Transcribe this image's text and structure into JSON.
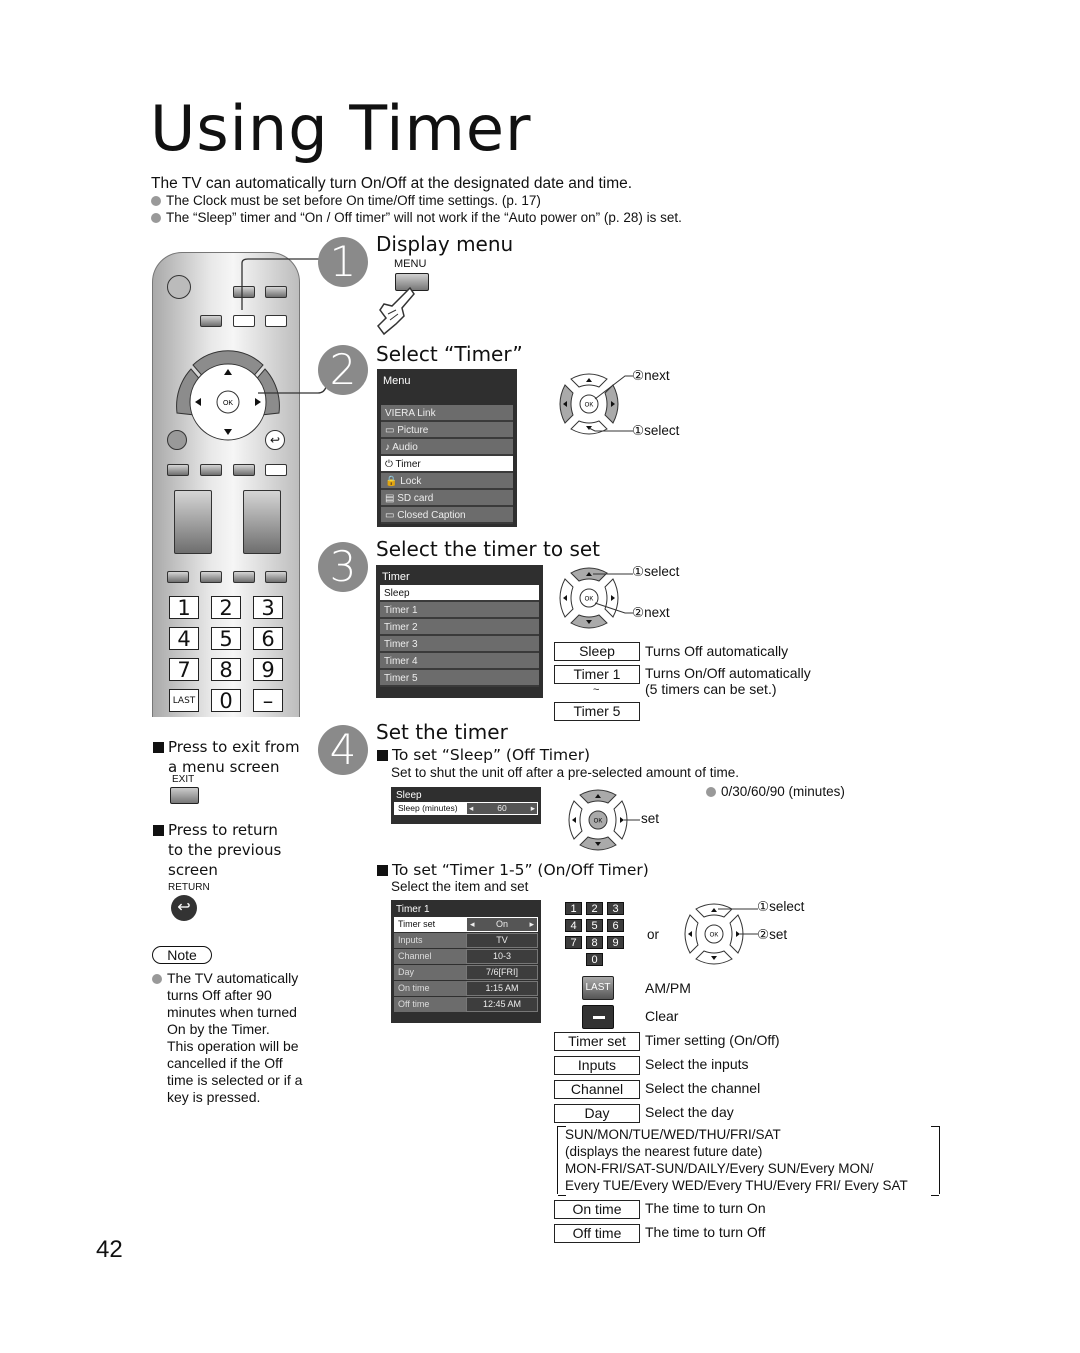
{
  "page": {
    "title": "Using Timer",
    "intro": "The TV can automatically turn On/Off at the designated date and time.",
    "bullets": [
      "The Clock must be set before On time/Off time settings. (p. 17)",
      "The “Sleep” timer and “On / Off timer” will not work if the “Auto power on” (p. 28) is set."
    ],
    "page_number": "42"
  },
  "steps": [
    {
      "num": "1",
      "title": "Display menu",
      "button_label": "MENU"
    },
    {
      "num": "2",
      "title": "Select “Timer”"
    },
    {
      "num": "3",
      "title": "Select the timer to set"
    },
    {
      "num": "4",
      "title": "Set the timer"
    }
  ],
  "menu_screen": {
    "header": "Menu",
    "items": [
      {
        "icon": "",
        "label": "VIERA Link",
        "selected": false
      },
      {
        "icon": "▭",
        "label": "Picture",
        "selected": false
      },
      {
        "icon": "♪",
        "label": "Audio",
        "selected": false
      },
      {
        "icon": "⏻",
        "label": "Timer",
        "selected": true
      },
      {
        "icon": "🔒",
        "label": "Lock",
        "selected": false
      },
      {
        "icon": "▤",
        "label": "SD card",
        "selected": false
      },
      {
        "icon": "▭",
        "label": "Closed Caption",
        "selected": false
      }
    ]
  },
  "step2_nav": {
    "next": "②next",
    "select": "①select"
  },
  "timer_screen": {
    "header": "Timer",
    "items": [
      {
        "label": "Sleep",
        "selected": true
      },
      {
        "label": "Timer 1",
        "selected": false
      },
      {
        "label": "Timer 2",
        "selected": false
      },
      {
        "label": "Timer 3",
        "selected": false
      },
      {
        "label": "Timer 4",
        "selected": false
      },
      {
        "label": "Timer 5",
        "selected": false
      }
    ]
  },
  "step3_nav": {
    "select": "①select",
    "next": "②next"
  },
  "step3_legend": [
    {
      "box": "Sleep",
      "text": "Turns Off automatically"
    },
    {
      "box": "Timer 1",
      "text": "Turns On/Off automatically"
    },
    {
      "box": "",
      "text": "(5 timers can be set.)",
      "tilde": "~"
    },
    {
      "box": "Timer 5",
      "text": ""
    }
  ],
  "sleep_section": {
    "heading": "To set “Sleep” (Off Timer)",
    "desc": "Set to shut the unit off after a pre-selected amount of time.",
    "screen_header": "Sleep",
    "row_label": "Sleep (minutes)",
    "row_value": "60",
    "options": "0/30/60/90 (minutes)",
    "nav_set": "set"
  },
  "timer15_section": {
    "heading": "To set “Timer 1-5” (On/Off Timer)",
    "desc": "Select the item and set",
    "screen_header": "Timer 1",
    "rows": [
      {
        "label": "Timer set",
        "value": "On",
        "selected": true
      },
      {
        "label": "Inputs",
        "value": "TV",
        "selected": false
      },
      {
        "label": "Channel",
        "value": "10-3",
        "selected": false
      },
      {
        "label": "Day",
        "value": "7/6[FRI]",
        "selected": false
      },
      {
        "label": "On time",
        "value": "1:15 AM",
        "selected": false
      },
      {
        "label": "Off time",
        "value": "12:45 AM",
        "selected": false
      }
    ],
    "keypad": [
      "1",
      "2",
      "3",
      "4",
      "5",
      "6",
      "7",
      "8",
      "9",
      "0"
    ],
    "or": "or",
    "nav_select": "①select",
    "nav_set": "②set",
    "last_label": "LAST",
    "last_desc": "AM/PM",
    "clear_desc": "Clear",
    "legend": [
      {
        "box": "Timer set",
        "text": "Timer setting (On/Off)"
      },
      {
        "box": "Inputs",
        "text": "Select the inputs"
      },
      {
        "box": "Channel",
        "text": "Select the channel"
      },
      {
        "box": "Day",
        "text": "Select the day"
      }
    ],
    "day_options": [
      "SUN/MON/TUE/WED/THU/FRI/SAT",
      "(displays the nearest future date)",
      "MON-FRI/SAT-SUN/DAILY/Every SUN/Every MON/",
      "Every TUE/Every WED/Every THU/Every FRI/ Every SAT"
    ],
    "legend2": [
      {
        "box": "On time",
        "text": "The time to turn On"
      },
      {
        "box": "Off time",
        "text": "The time to turn Off"
      }
    ]
  },
  "side": {
    "exit_text_1": "Press to exit from",
    "exit_text_2": "a menu screen",
    "exit_label": "EXIT",
    "return_text_1": "Press to return",
    "return_text_2": "to the previous",
    "return_text_3": "screen",
    "return_label": "RETURN",
    "note_label": "Note",
    "note_lines": [
      "The TV automatically",
      "turns Off after 90",
      "minutes when turned",
      "On by the Timer.",
      "This operation will be",
      "cancelled if the Off",
      "time is selected or if a",
      "key is pressed."
    ]
  },
  "remote": {
    "numbers": [
      "1",
      "2",
      "3",
      "4",
      "5",
      "6",
      "7",
      "8",
      "9",
      "LAST",
      "0",
      "–"
    ],
    "ok": "OK"
  }
}
